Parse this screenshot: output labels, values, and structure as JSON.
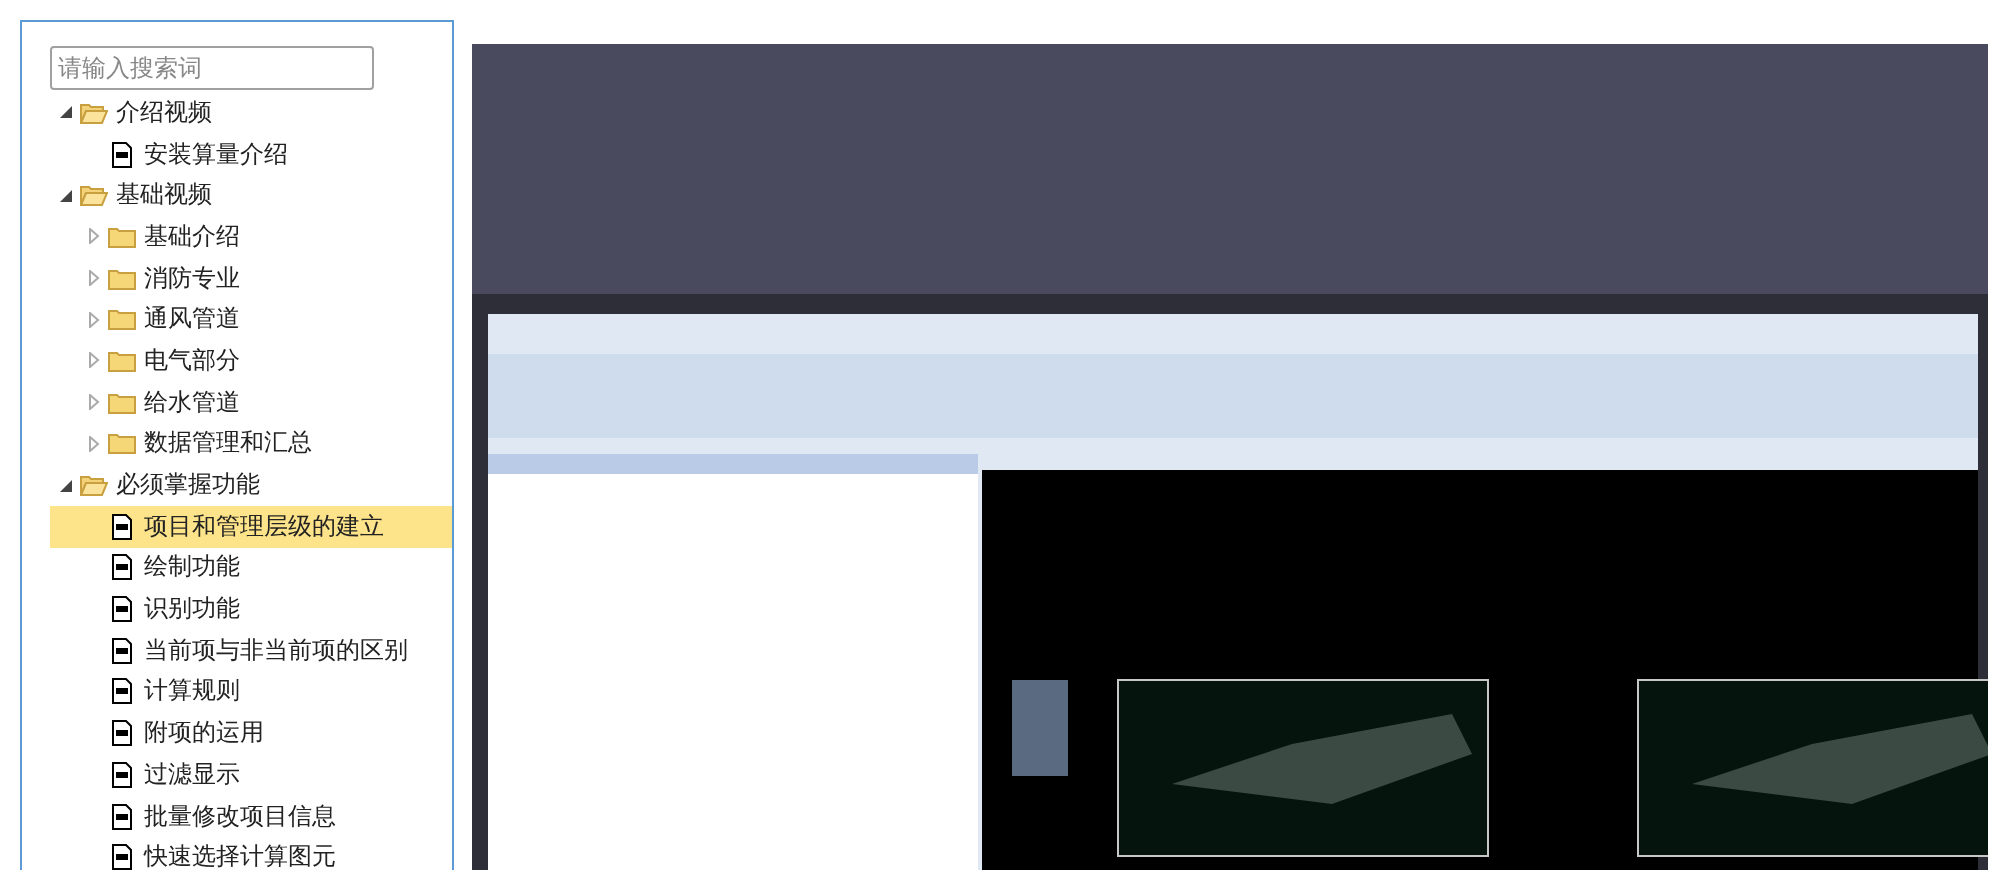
{
  "search": {
    "placeholder": "请输入搜索词"
  },
  "tree": [
    {
      "kind": "folder",
      "label": "介绍视频",
      "expanded": true,
      "selected": false,
      "children": [
        {
          "kind": "file",
          "label": "安装算量介绍",
          "selected": false
        }
      ]
    },
    {
      "kind": "folder",
      "label": "基础视频",
      "expanded": true,
      "selected": false,
      "children": [
        {
          "kind": "folder",
          "label": "基础介绍",
          "expanded": false,
          "selected": false
        },
        {
          "kind": "folder",
          "label": "消防专业",
          "expanded": false,
          "selected": false
        },
        {
          "kind": "folder",
          "label": "通风管道",
          "expanded": false,
          "selected": false
        },
        {
          "kind": "folder",
          "label": "电气部分",
          "expanded": false,
          "selected": false
        },
        {
          "kind": "folder",
          "label": "给水管道",
          "expanded": false,
          "selected": false
        },
        {
          "kind": "folder",
          "label": "数据管理和汇总",
          "expanded": false,
          "selected": false
        }
      ]
    },
    {
      "kind": "folder",
      "label": "必须掌握功能",
      "expanded": true,
      "selected": false,
      "children": [
        {
          "kind": "file",
          "label": "项目和管理层级的建立",
          "selected": true
        },
        {
          "kind": "file",
          "label": "绘制功能",
          "selected": false
        },
        {
          "kind": "file",
          "label": "识别功能",
          "selected": false
        },
        {
          "kind": "file",
          "label": "当前项与非当前项的区别",
          "selected": false
        },
        {
          "kind": "file",
          "label": "计算规则",
          "selected": false
        },
        {
          "kind": "file",
          "label": "附项的运用",
          "selected": false
        },
        {
          "kind": "file",
          "label": "过滤显示",
          "selected": false
        },
        {
          "kind": "file",
          "label": "批量修改项目信息",
          "selected": false
        },
        {
          "kind": "file",
          "label": "快速选择计算图元",
          "selected": false
        }
      ]
    }
  ]
}
